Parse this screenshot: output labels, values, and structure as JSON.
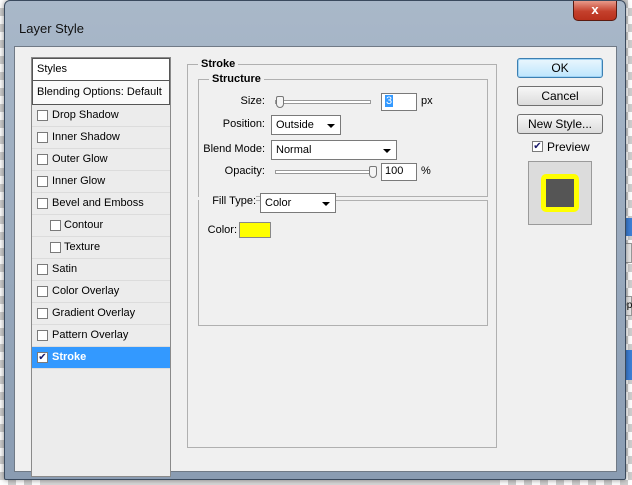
{
  "window": {
    "title": "Layer Style",
    "close_glyph": "x"
  },
  "styles": {
    "header": "Styles",
    "blending_options": "Blending Options: Default",
    "items": [
      {
        "label": "Drop Shadow",
        "checked": false,
        "indent": false,
        "selected": false
      },
      {
        "label": "Inner Shadow",
        "checked": false,
        "indent": false,
        "selected": false
      },
      {
        "label": "Outer Glow",
        "checked": false,
        "indent": false,
        "selected": false
      },
      {
        "label": "Inner Glow",
        "checked": false,
        "indent": false,
        "selected": false
      },
      {
        "label": "Bevel and Emboss",
        "checked": false,
        "indent": false,
        "selected": false
      },
      {
        "label": "Contour",
        "checked": false,
        "indent": true,
        "selected": false
      },
      {
        "label": "Texture",
        "checked": false,
        "indent": true,
        "selected": false
      },
      {
        "label": "Satin",
        "checked": false,
        "indent": false,
        "selected": false
      },
      {
        "label": "Color Overlay",
        "checked": false,
        "indent": false,
        "selected": false
      },
      {
        "label": "Gradient Overlay",
        "checked": false,
        "indent": false,
        "selected": false
      },
      {
        "label": "Pattern Overlay",
        "checked": false,
        "indent": false,
        "selected": false
      },
      {
        "label": "Stroke",
        "checked": true,
        "indent": false,
        "selected": true
      }
    ]
  },
  "stroke": {
    "section_title": "Stroke",
    "structure_title": "Structure",
    "size_label": "Size:",
    "size_value": "3",
    "size_unit": "px",
    "size_slider_fraction": 0.03,
    "position_label": "Position:",
    "position_value": "Outside",
    "blend_mode_label": "Blend Mode:",
    "blend_mode_value": "Normal",
    "opacity_label": "Opacity:",
    "opacity_value": "100",
    "opacity_unit": "%",
    "opacity_slider_fraction": 1.0,
    "fill_type_label": "Fill Type:",
    "fill_type_value": "Color",
    "color_label": "Color:",
    "color_value": "#ffff00"
  },
  "buttons": {
    "ok": "OK",
    "cancel": "Cancel",
    "new_style": "New Style...",
    "preview_label": "Preview",
    "preview_checked": true
  },
  "colors": {
    "selection": "#3399ff",
    "stroke_color": "#ffff00",
    "preview_fill": "#555555"
  },
  "background": {
    "side_tag_1": "A",
    "side_tag_2": "Op"
  }
}
